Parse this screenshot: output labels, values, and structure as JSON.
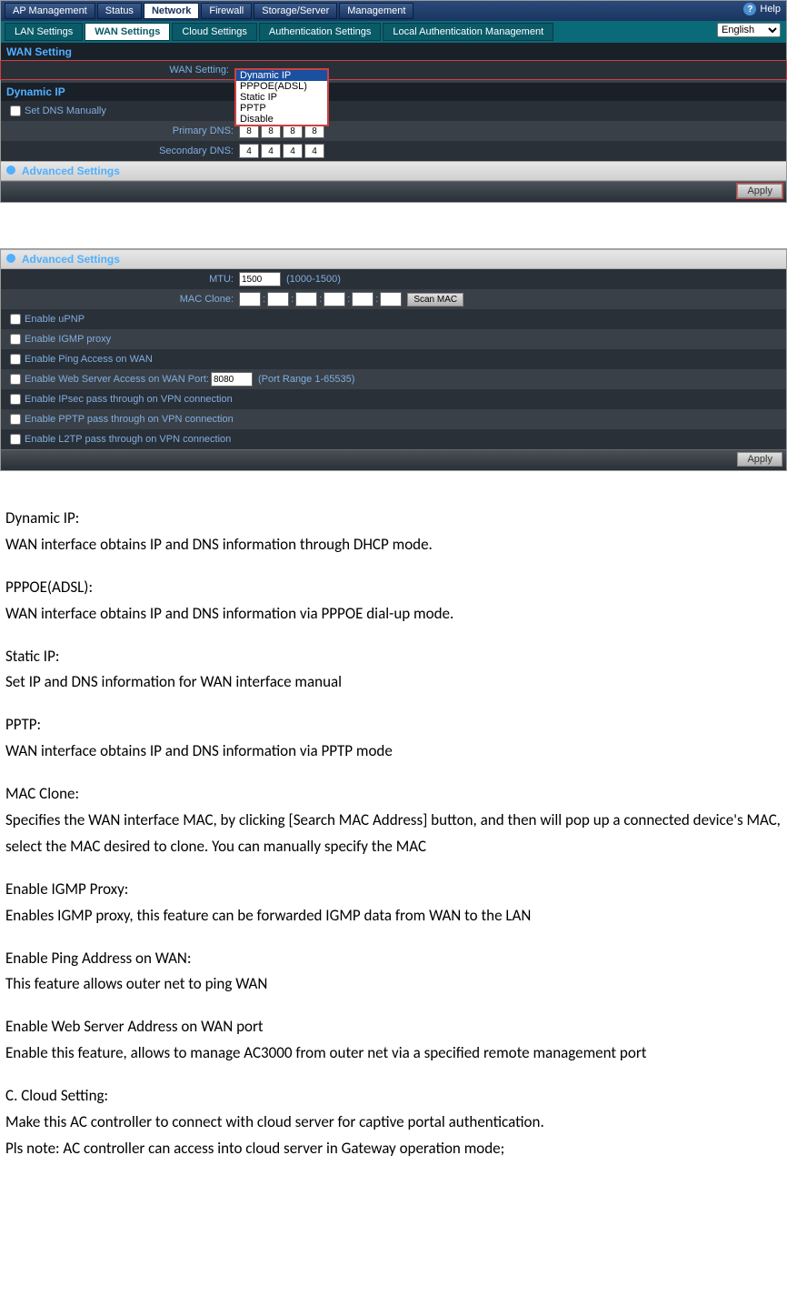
{
  "topnav": {
    "tabs": [
      "AP Management",
      "Status",
      "Network",
      "Firewall",
      "Storage/Server",
      "Management"
    ],
    "help": "Help"
  },
  "subnav": {
    "tabs": [
      "LAN Settings",
      "WAN Settings",
      "Cloud Settings",
      "Authentication Settings",
      "Local Authentication Management"
    ],
    "language": "English"
  },
  "panel1": {
    "wan_setting_hdr": "WAN Setting",
    "wan_setting_lbl": "WAN Setting:",
    "dropdown": [
      "Dynamic IP",
      "PPPOE(ADSL)",
      "Static IP",
      "PPTP",
      "Disable"
    ],
    "dynamic_ip_hdr": "Dynamic IP",
    "set_dns_manually": "Set DNS Manually",
    "primary_dns_lbl": "Primary DNS:",
    "primary_dns": [
      "8",
      "8",
      "8",
      "8"
    ],
    "secondary_dns_lbl": "Secondary DNS:",
    "secondary_dns": [
      "4",
      "4",
      "4",
      "4"
    ],
    "advanced_hdr": "Advanced Settings",
    "apply": "Apply"
  },
  "panel2": {
    "advanced_hdr": "Advanced Settings",
    "mtu_lbl": "MTU:",
    "mtu_val": "1500",
    "mtu_hint": "(1000-1500)",
    "mac_clone_lbl": "MAC Clone:",
    "scan_mac": "Scan MAC",
    "opts": {
      "upnp": "Enable uPNP",
      "igmp": "Enable IGMP proxy",
      "ping": "Enable Ping Access on WAN",
      "webport_pre": "Enable Web Server Access on WAN Port:",
      "webport_val": "8080",
      "webport_hint": "(Port Range 1-65535)",
      "ipsec": "Enable IPsec pass through on VPN connection",
      "pptp": "Enable PPTP pass through on VPN connection",
      "l2tp": "Enable L2TP pass through on VPN connection"
    },
    "apply": "Apply"
  },
  "doc": {
    "p1a": "Dynamic IP:",
    "p1b": "WAN interface obtains IP and DNS information through DHCP mode.",
    "p2a": "PPPOE(ADSL):",
    "p2b": "WAN interface obtains IP and DNS information via PPPOE dial-up mode.",
    "p3a": "Static IP:",
    "p3b": "Set IP and DNS information for WAN interface manual",
    "p4a": "PPTP:",
    "p4b": "WAN interface obtains IP and DNS information via PPTP mode",
    "p5a": "MAC Clone:",
    "p5b": "Specifies the WAN interface MAC, by clicking [Search MAC Address] button, and then will pop up a connected device's MAC, select the MAC desired to clone. You can manually specify the MAC",
    "p6a": "Enable IGMP Proxy:",
    "p6b": "Enables IGMP proxy, this feature can be forwarded IGMP data from WAN to the LAN",
    "p7a": "Enable Ping Address on WAN:",
    "p7b": "This feature allows outer net to ping WAN",
    "p8a": "Enable Web Server Address on WAN port",
    "p8b": "Enable this feature,  allows to manage AC3000 from outer net via a specified remote management port",
    "p9a": "C. Cloud Setting:",
    "p9b": "Make this AC controller to connect with cloud server for captive portal authentication.",
    "p9c": "Pls note: AC controller can access into cloud server in Gateway operation mode;"
  }
}
